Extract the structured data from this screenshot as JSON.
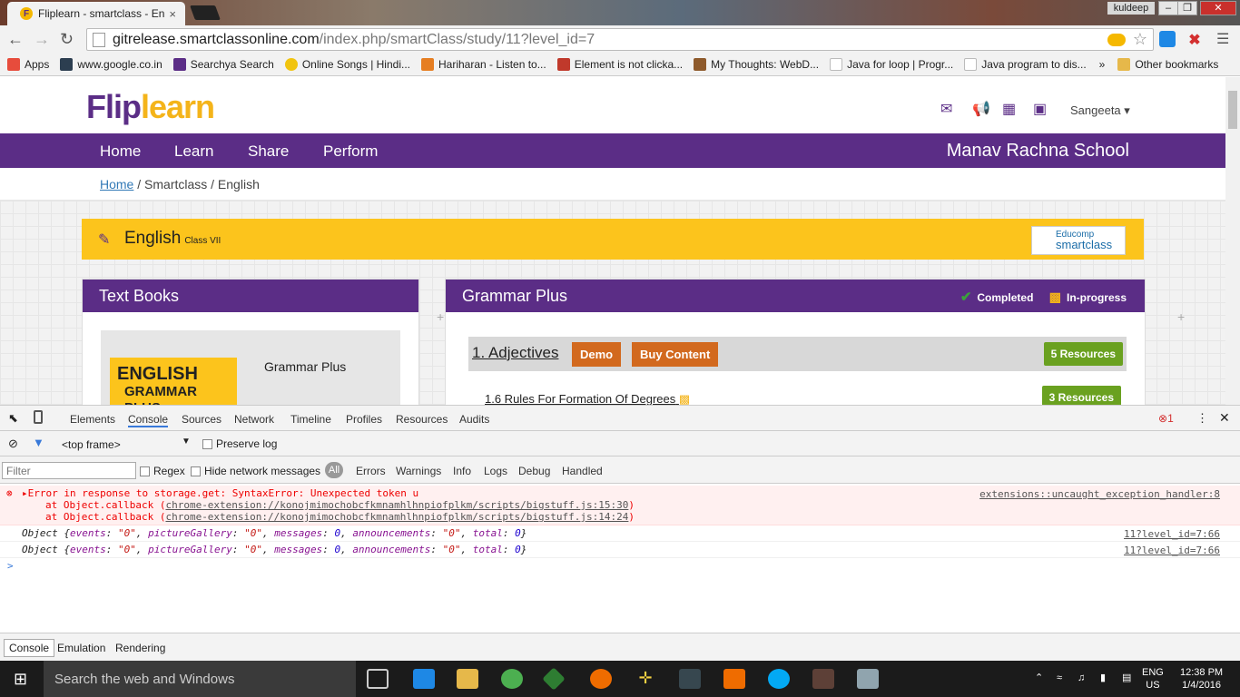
{
  "browser": {
    "tab_title": "Fliplearn - smartclass - En",
    "tab_favicon": "F",
    "tab_close": "×",
    "window_user": "kuldeep",
    "win_min": "–",
    "win_max": "❐",
    "win_close": "✕",
    "url_host": "gitrelease.smartclassonline.com",
    "url_path": "/index.php/smartClass/study/11?level_id=7",
    "bookmarks": [
      {
        "label": "Apps",
        "color": "#e74c3c"
      },
      {
        "label": "www.google.co.in",
        "color": "#2c3e50"
      },
      {
        "label": "Searchya Search",
        "color": "#5b2d86"
      },
      {
        "label": "Online Songs | Hindi...",
        "color": "#f1c40f"
      },
      {
        "label": "Hariharan - Listen to...",
        "color": "#e67e22"
      },
      {
        "label": "Element is not clicka...",
        "color": "#c0392b"
      },
      {
        "label": "My Thoughts: WebD...",
        "color": "#8e5a2b"
      },
      {
        "label": "Java for loop | Progr...",
        "color": "#bbb"
      },
      {
        "label": "Java program to dis...",
        "color": "#bbb"
      }
    ],
    "bookmarks_more": "»",
    "other_bookmarks": "Other bookmarks"
  },
  "site": {
    "logo_flip": "Flip",
    "logo_learn": "learn",
    "user_name": "Sangeeta",
    "nav": [
      "Home",
      "Learn",
      "Share",
      "Perform"
    ],
    "school": "Manav Rachna School",
    "breadcrumb_home": "Home",
    "breadcrumb_rest": " / Smartclass / English",
    "subject": "English",
    "subject_class": "Class VII",
    "brand_top": "Educomp",
    "brand_name": "smartclass",
    "textbooks_title": "Text Books",
    "cover_line1": "ENGLISH",
    "cover_line2": "GRAMMAR PLUS",
    "book_name": "Grammar Plus",
    "panel_title": "Grammar Plus",
    "legend_completed": "Completed",
    "legend_inprogress": "In-progress",
    "chapter_title": "1. Adjectives",
    "demo_label": "Demo",
    "buy_label": "Buy Content",
    "chapter_resources": "5 Resources",
    "subtopic": "1.6 Rules For Formation Of Degrees",
    "subtopic_resources": "3 Resources"
  },
  "devtools": {
    "tabs": [
      "Elements",
      "Console",
      "Sources",
      "Network",
      "Timeline",
      "Profiles",
      "Resources",
      "Audits"
    ],
    "error_count": "1",
    "frame": "<top frame>",
    "preserve_log": "Preserve log",
    "filter_placeholder": "Filter",
    "regex": "Regex",
    "hide_network": "Hide network messages",
    "levels": [
      "All",
      "Errors",
      "Warnings",
      "Info",
      "Logs",
      "Debug",
      "Handled"
    ],
    "error_msg": "Error in response to storage.get: SyntaxError: Unexpected token u",
    "error_src": "extensions::uncaught_exception_handler:8",
    "stack1_pre": "at Object.callback (",
    "stack1_link": "chrome-extension://konojmimochobcfkmnamhlhnpiofplkm/scripts/bigstuff.js:15:30",
    "stack2_link": "chrome-extension://konojmimochobcfkmnamhlhnpiofplkm/scripts/bigstuff.js:14:24",
    "stack_close": ")",
    "log_src": "11?level_id=7:66",
    "drawer_tabs": [
      "Console",
      "Emulation",
      "Rendering"
    ]
  },
  "taskbar": {
    "search": "Search the web and Windows",
    "lang1": "ENG",
    "lang2": "US",
    "time": "12:38 PM",
    "date": "1/4/2016"
  }
}
